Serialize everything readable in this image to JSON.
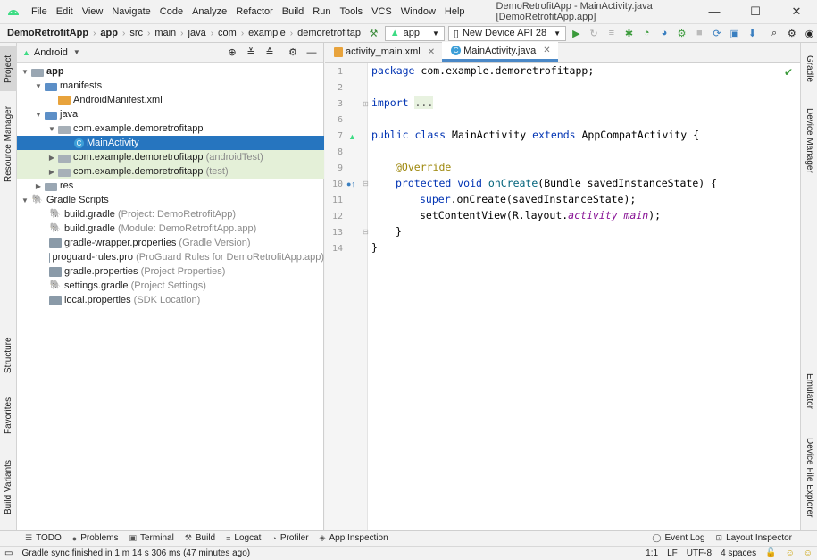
{
  "window": {
    "title": "DemoRetrofitApp - MainActivity.java [DemoRetrofitApp.app]",
    "controls": [
      "—",
      "☐",
      "✕"
    ]
  },
  "menu": [
    {
      "label": "File"
    },
    {
      "label": "Edit"
    },
    {
      "label": "View"
    },
    {
      "label": "Navigate"
    },
    {
      "label": "Code"
    },
    {
      "label": "Analyze"
    },
    {
      "label": "Refactor"
    },
    {
      "label": "Build"
    },
    {
      "label": "Run"
    },
    {
      "label": "Tools"
    },
    {
      "label": "VCS"
    },
    {
      "label": "Window"
    },
    {
      "label": "Help"
    }
  ],
  "breadcrumb": [
    "DemoRetrofitApp",
    "app",
    "src",
    "main",
    "java",
    "com",
    "example",
    "demoretrofitap"
  ],
  "toolbar": {
    "run_config": "app",
    "device": "New Device API 28"
  },
  "left_tabs": [
    "Project",
    "Resource Manager",
    "Structure",
    "Favorites",
    "Build Variants"
  ],
  "right_tabs": [
    "Gradle",
    "Device Manager",
    "Emulator",
    "Device File Explorer"
  ],
  "project_panel": {
    "view_mode": "Android",
    "tree": [
      {
        "label": "app",
        "hint": "",
        "bold": true
      },
      {
        "label": "manifests",
        "hint": ""
      },
      {
        "label": "AndroidManifest.xml",
        "hint": ""
      },
      {
        "label": "java",
        "hint": ""
      },
      {
        "label": "com.example.demoretrofitapp",
        "hint": ""
      },
      {
        "label": "MainActivity",
        "hint": ""
      },
      {
        "label": "com.example.demoretrofitapp",
        "hint": "(androidTest)"
      },
      {
        "label": "com.example.demoretrofitapp",
        "hint": "(test)"
      },
      {
        "label": "res",
        "hint": ""
      },
      {
        "label": "Gradle Scripts",
        "hint": ""
      },
      {
        "label": "build.gradle",
        "hint": "(Project: DemoRetrofitApp)"
      },
      {
        "label": "build.gradle",
        "hint": "(Module: DemoRetrofitApp.app)"
      },
      {
        "label": "gradle-wrapper.properties",
        "hint": "(Gradle Version)"
      },
      {
        "label": "proguard-rules.pro",
        "hint": "(ProGuard Rules for DemoRetrofitApp.app)"
      },
      {
        "label": "gradle.properties",
        "hint": "(Project Properties)"
      },
      {
        "label": "settings.gradle",
        "hint": "(Project Settings)"
      },
      {
        "label": "local.properties",
        "hint": "(SDK Location)"
      }
    ]
  },
  "editor": {
    "tabs": [
      {
        "label": "activity_main.xml"
      },
      {
        "label": "MainActivity.java"
      }
    ],
    "line_numbers": [
      "1",
      "2",
      "3",
      "6",
      "7",
      "8",
      "9",
      "10",
      "11",
      "12",
      "13",
      "14"
    ],
    "code": {
      "l1_kw": "package",
      "l1_rest": " com.example.demoretrofitapp;",
      "l3_kw": "import",
      "l3_fold": "...",
      "l7_kw1": "public",
      "l7_kw2": "class",
      "l7_name": "MainActivity",
      "l7_kw3": "extends",
      "l7_rest": "AppCompatActivity {",
      "l9_ann": "@Override",
      "l10_kw1": "protected",
      "l10_kw2": "void",
      "l10_fn": "onCreate",
      "l10_rest": "(Bundle savedInstanceState) {",
      "l11_kw": "super",
      "l11_rest": ".onCreate(savedInstanceState);",
      "l12_pre": "setContentView(R.layout.",
      "l12_it": "activity_main",
      "l12_post": ");",
      "l13": "}",
      "l14": "}"
    }
  },
  "bottom_tools": [
    {
      "label": "TODO"
    },
    {
      "label": "Problems"
    },
    {
      "label": "Terminal"
    },
    {
      "label": "Build"
    },
    {
      "label": "Logcat"
    },
    {
      "label": "Profiler"
    },
    {
      "label": "App Inspection"
    }
  ],
  "bottom_tools_right": [
    {
      "label": "Event Log"
    },
    {
      "label": "Layout Inspector"
    }
  ],
  "status": {
    "message": "Gradle sync finished in 1 m 14 s 306 ms (47 minutes ago)",
    "position": "1:1",
    "line_sep": "LF",
    "encoding": "UTF-8",
    "indent": "4 spaces"
  }
}
